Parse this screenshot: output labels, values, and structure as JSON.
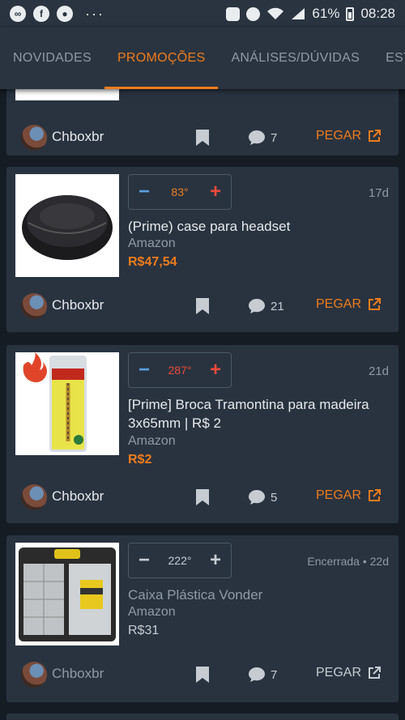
{
  "status_bar": {
    "battery": "61%",
    "time": "08:28",
    "dots": "···"
  },
  "tabs": [
    {
      "label": "NOVIDADES",
      "active": false
    },
    {
      "label": "PROMOÇÕES",
      "active": true
    },
    {
      "label": "ANÁLISES/DÚVIDAS",
      "active": false
    },
    {
      "label": "ESTATÍS",
      "active": false
    }
  ],
  "deals": [
    {
      "partial": true,
      "user": "Chboxbr",
      "comments": "7",
      "action": "PEGAR"
    },
    {
      "temperature": "83°",
      "age": "17d",
      "title": "(Prime) case para headset",
      "store": "Amazon",
      "price": "R$47,54",
      "user": "Chboxbr",
      "comments": "21",
      "action": "PEGAR",
      "image": "headset-case"
    },
    {
      "temperature": "287°",
      "age": "21d",
      "title": "[Prime] Broca Tramontina para madeira 3x65mm | R$ 2",
      "store": "Amazon",
      "price": "R$2",
      "user": "Chboxbr",
      "comments": "5",
      "action": "PEGAR",
      "image": "drill-bit-package"
    },
    {
      "temperature": "222°",
      "age": "Encerrada • 22d",
      "title": "Caixa Plástica Vonder",
      "store": "Amazon",
      "price": "R$31",
      "user": "Chboxbr",
      "comments": "7",
      "action": "PEGAR",
      "image": "plastic-toolbox",
      "expired": true
    }
  ],
  "colors": {
    "accent": "#f07c1c",
    "card": "#293340",
    "background": "#151c24",
    "hot": "#f04a3a",
    "cold": "#5aa0dc"
  }
}
